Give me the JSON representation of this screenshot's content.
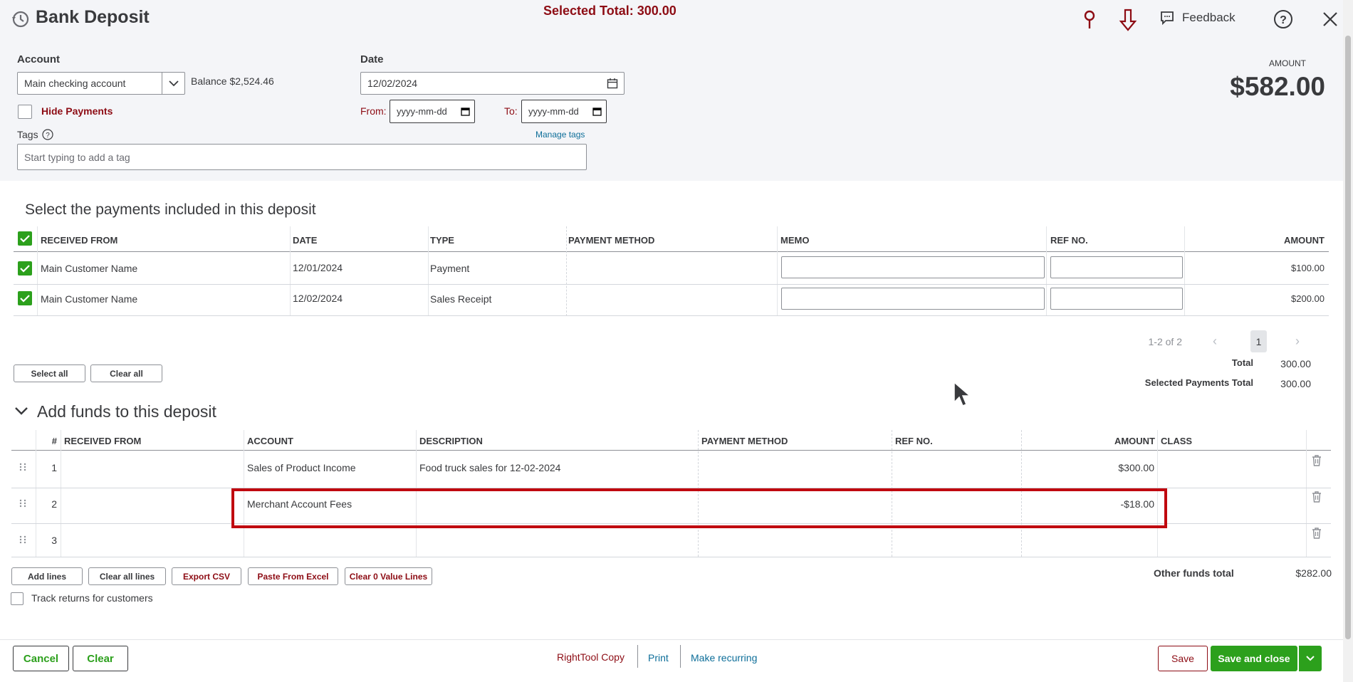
{
  "header": {
    "title": "Bank Deposit",
    "selected_total": "Selected Total: 300.00",
    "feedback": "Feedback"
  },
  "account": {
    "label": "Account",
    "value": "Main checking account",
    "balance_label": "Balance",
    "balance_value": "$2,524.46",
    "hide_payments": "Hide Payments"
  },
  "date": {
    "label": "Date",
    "value": "12/02/2024",
    "from_label": "From:",
    "to_label": "To:",
    "from_placeholder": "yyyy-mm-dd",
    "to_placeholder": "yyyy-mm-dd"
  },
  "tags": {
    "label": "Tags",
    "manage": "Manage tags",
    "placeholder": "Start typing to add a tag"
  },
  "amount": {
    "label": "AMOUNT",
    "value": "$582.00"
  },
  "payments": {
    "title": "Select the payments included in this deposit",
    "columns": [
      "RECEIVED FROM",
      "DATE",
      "TYPE",
      "PAYMENT METHOD",
      "MEMO",
      "REF NO.",
      "AMOUNT"
    ],
    "rows": [
      {
        "received_from": "Main Customer Name",
        "date": "12/01/2024",
        "type": "Payment",
        "amount": "$100.00"
      },
      {
        "received_from": "Main Customer Name",
        "date": "12/02/2024",
        "type": "Sales Receipt",
        "amount": "$200.00"
      }
    ],
    "pagination": "1-2 of 2",
    "page": "1",
    "select_all": "Select all",
    "clear_all": "Clear all",
    "total_label": "Total",
    "total_value": "300.00",
    "selected_label": "Selected Payments Total",
    "selected_value": "300.00"
  },
  "funds": {
    "title": "Add funds to this deposit",
    "columns": [
      "#",
      "RECEIVED FROM",
      "ACCOUNT",
      "DESCRIPTION",
      "PAYMENT METHOD",
      "REF NO.",
      "AMOUNT",
      "CLASS"
    ],
    "rows": [
      {
        "num": "1",
        "account": "Sales of Product Income",
        "description": "Food truck sales for 12-02-2024",
        "amount": "$300.00"
      },
      {
        "num": "2",
        "account": "Merchant Account Fees",
        "description": "",
        "amount": "-$18.00"
      },
      {
        "num": "3",
        "account": "",
        "description": "",
        "amount": ""
      }
    ],
    "add_lines": "Add lines",
    "clear_all_lines": "Clear all lines",
    "export_csv": "Export CSV",
    "paste_excel": "Paste From Excel",
    "clear_zero": "Clear 0 Value Lines",
    "other_total_label": "Other funds total",
    "other_total_value": "$282.00",
    "track_returns": "Track returns for customers"
  },
  "footer": {
    "cancel": "Cancel",
    "clear": "Clear",
    "righttool": "RightTool Copy",
    "print": "Print",
    "make_recurring": "Make recurring",
    "save": "Save",
    "save_close": "Save and close"
  },
  "colors": {
    "accent_green": "#2ca01c",
    "maroon": "#8d0c14",
    "link_blue": "#0d6e99",
    "highlight_red": "#c0080f"
  }
}
